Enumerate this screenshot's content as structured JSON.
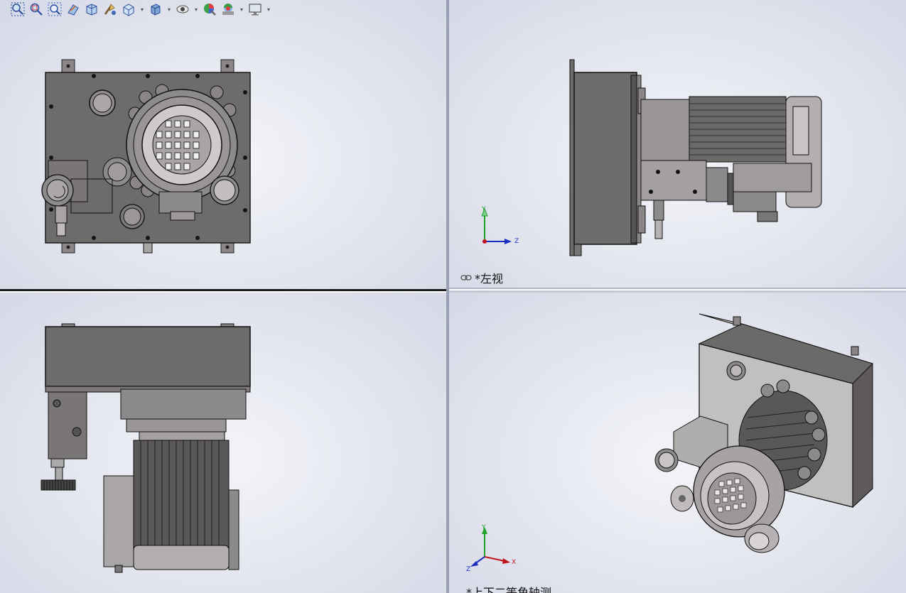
{
  "heads_up_toolbar": {
    "tools": [
      {
        "name": "zoom-to-fit-icon"
      },
      {
        "name": "zoom-to-area-icon"
      },
      {
        "name": "previous-view-icon"
      },
      {
        "name": "section-view-icon"
      },
      {
        "name": "dynamic-annotation-icon"
      },
      {
        "name": "view-orientation-icon",
        "dropdown": true
      },
      {
        "name": "display-style-icon",
        "dropdown": true
      },
      {
        "name": "hide-show-items-icon",
        "dropdown": true
      },
      {
        "name": "edit-appearance-icon"
      },
      {
        "name": "apply-scene-icon",
        "dropdown": true
      },
      {
        "name": "view-settings-icon",
        "dropdown": true
      }
    ]
  },
  "viewports": {
    "front": {
      "label": ""
    },
    "left": {
      "label": "*左视",
      "linked": true,
      "triad": [
        "Y",
        "Z"
      ]
    },
    "top": {
      "label": ""
    },
    "iso": {
      "label": "*上下二等角轴测",
      "triad": [
        "Y",
        "X",
        "Z"
      ]
    }
  },
  "colors": {
    "housing": "#6e6b6b",
    "housing_light": "#a8a4a4",
    "motor": "#8d8a8b",
    "background_center": "#f4f5fa",
    "background_edge": "#d5d8e6",
    "axis_x": "#c0141c",
    "axis_y": "#1ea02a",
    "axis_z": "#1a2fbf"
  }
}
